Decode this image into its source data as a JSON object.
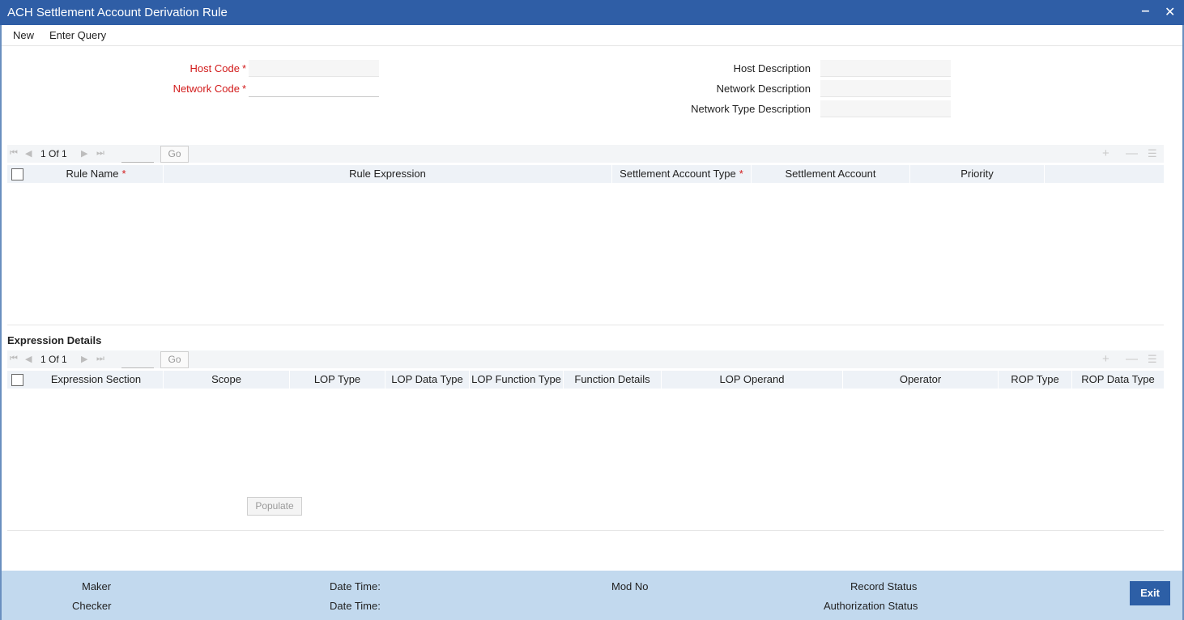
{
  "window": {
    "title": "ACH Settlement Account Derivation Rule",
    "minimize": "‒",
    "close": "✕"
  },
  "menu": {
    "new": "New",
    "enter_query": "Enter Query"
  },
  "form": {
    "host_code": {
      "label": "Host Code",
      "value": ""
    },
    "network_code": {
      "label": "Network Code",
      "value": ""
    },
    "host_description": {
      "label": "Host Description",
      "value": ""
    },
    "network_description": {
      "label": "Network Description",
      "value": ""
    },
    "network_type_description": {
      "label": "Network Type Description",
      "value": ""
    },
    "required_marker": "*"
  },
  "rules_grid": {
    "pager": {
      "page": "1",
      "of_label": "Of",
      "total": "1",
      "go": "Go"
    },
    "columns": [
      "Rule Name",
      "Rule Expression",
      "Settlement Account Type",
      "Settlement Account",
      "Priority"
    ],
    "required_marker": "*"
  },
  "expression_details": {
    "title": "Expression Details",
    "pager": {
      "page": "1",
      "of_label": "Of",
      "total": "1",
      "go": "Go"
    },
    "columns": [
      "Expression Section",
      "Scope",
      "LOP Type",
      "LOP Data Type",
      "LOP Function Type",
      "Function Details",
      "LOP Operand",
      "Operator",
      "ROP Type",
      "ROP Data Type"
    ]
  },
  "populate_button": "Populate",
  "icons": {
    "first": "first-page-icon",
    "prev": "previous-page-icon",
    "next": "next-page-icon",
    "last": "last-page-icon",
    "add": "add-row-icon",
    "delete": "delete-row-icon",
    "view": "single-view-icon"
  },
  "footer": {
    "maker": "Maker",
    "checker": "Checker",
    "date_time_1": "Date Time:",
    "date_time_2": "Date Time:",
    "mod_no": "Mod No",
    "record_status": "Record Status",
    "authorization_status": "Authorization Status",
    "exit": "Exit"
  },
  "colors": {
    "title_bar": "#2f5ea6",
    "footer": "#c2d9ee",
    "required": "#d21b1b",
    "exit_button": "#2d5fa6"
  }
}
